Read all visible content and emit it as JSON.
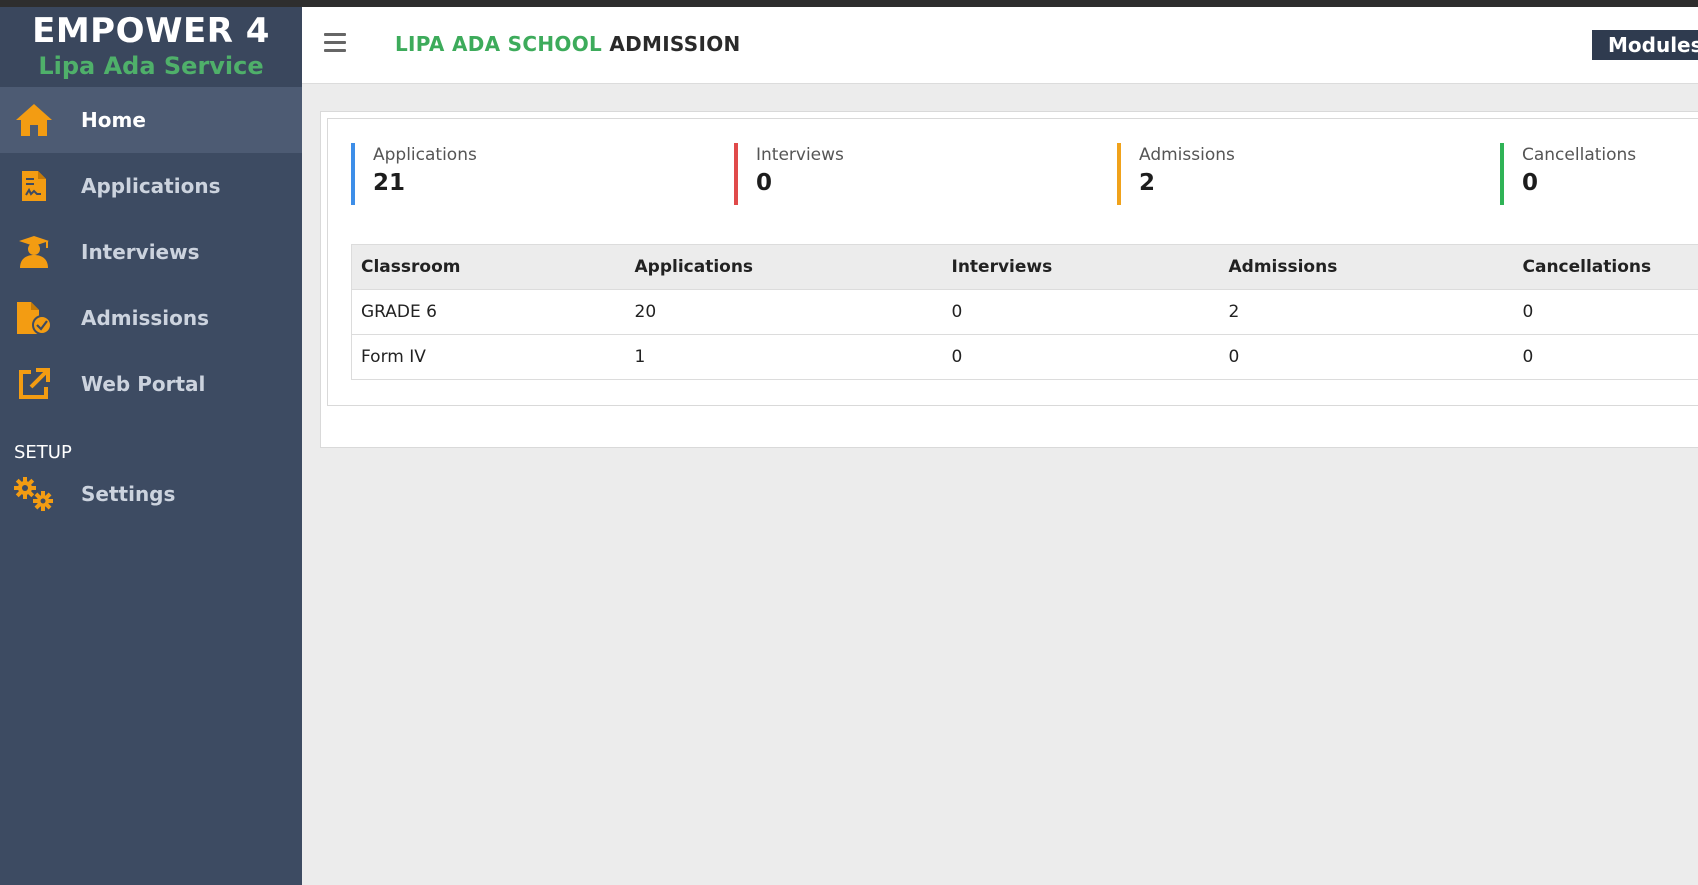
{
  "brand": {
    "title": "EMPOWER 4",
    "subtitle": "Lipa Ada Service"
  },
  "sidebar": {
    "items": [
      {
        "label": "Home",
        "icon": "home-icon",
        "active": true
      },
      {
        "label": "Applications",
        "icon": "file-signature-icon"
      },
      {
        "label": "Interviews",
        "icon": "graduate-user-icon"
      },
      {
        "label": "Admissions",
        "icon": "file-check-icon"
      },
      {
        "label": "Web Portal",
        "icon": "external-link-icon"
      }
    ],
    "section_label": "SETUP",
    "settings": {
      "label": "Settings",
      "icon": "gears-icon"
    }
  },
  "header": {
    "title_school": "LIPA ADA SCHOOL",
    "title_suffix": "ADMISSION",
    "modules_label": "Modules"
  },
  "stats": [
    {
      "label": "Applications",
      "value": "21",
      "color": "#3d8ee8"
    },
    {
      "label": "Interviews",
      "value": "0",
      "color": "#e04a4a"
    },
    {
      "label": "Admissions",
      "value": "2",
      "color": "#f0a21b"
    },
    {
      "label": "Cancellations",
      "value": "0",
      "color": "#2fb356"
    }
  ],
  "table": {
    "headers": [
      "Classroom",
      "Applications",
      "Interviews",
      "Admissions",
      "Cancellations"
    ],
    "rows": [
      [
        "GRADE 6",
        "20",
        "0",
        "2",
        "0"
      ],
      [
        "Form IV",
        "1",
        "0",
        "0",
        "0"
      ]
    ]
  },
  "colors": {
    "accent": "#f39c12",
    "sidebar": "#3d4b62",
    "brand_green": "#4fb06a"
  }
}
